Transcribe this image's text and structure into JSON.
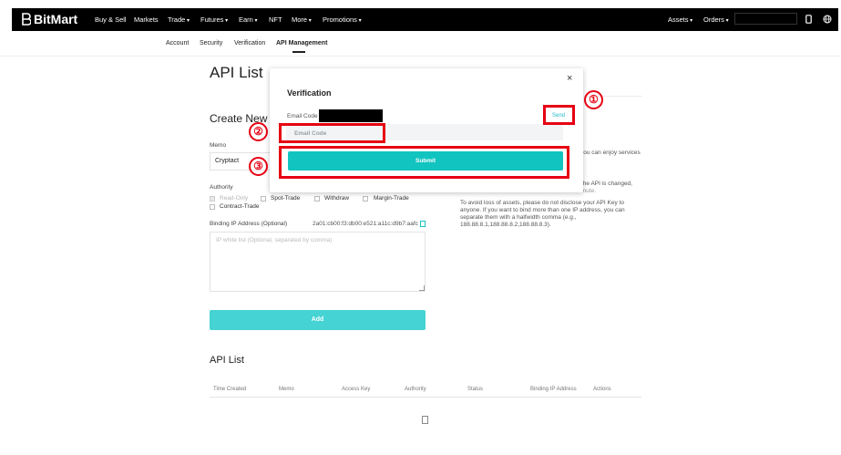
{
  "nav": {
    "logo": "BitMart",
    "items": [
      "Buy & Sell",
      "Markets",
      "Trade",
      "Futures",
      "Earn",
      "NFT",
      "More",
      "Promotions"
    ],
    "right": [
      "Assets",
      "Orders"
    ]
  },
  "subnav": [
    "Account",
    "Security",
    "Verification",
    "API Management"
  ],
  "page": {
    "title": "API List",
    "create_title": "Create New A",
    "memo_label": "Memo",
    "memo_value": "Cryptact",
    "authority_label": "Authority",
    "authority_options": [
      {
        "label": "Read-Only",
        "checked": true,
        "disabled": true
      },
      {
        "label": "Spot-Trade",
        "checked": false
      },
      {
        "label": "Withdraw",
        "checked": false
      },
      {
        "label": "Margin-Trade",
        "checked": false
      },
      {
        "label": "Contract-Trade",
        "checked": false
      }
    ],
    "ip_label": "Binding IP Address (Optional)",
    "ip_value": "2a01:cb00:f3:db00:e521:a11c:d9b7:aafc",
    "ip_placeholder": "IP white list (Optional, separated by comma)",
    "add_button": "Add",
    "api_list_title": "API List",
    "table_headers": [
      "Time Created",
      "Memo",
      "Access Key",
      "Authority",
      "Status",
      "Binding IP Address",
      "Actions"
    ],
    "notes": [
      "you can enjoy services",
      "r the API is changed,",
      "the instance function will take effect within 1 minute.",
      "To avoid loss of assets, please do not disclose your API Key to",
      "anyone. If you want to bind more than one IP address, you can",
      "separate them with a halfwidth comma (e.g.,",
      "188.88.8.1,188.88.8.2,188.88.8.3)."
    ]
  },
  "modal": {
    "title": "Verification",
    "close": "×",
    "email_label": "Email Code",
    "send": "Send",
    "placeholder": "Email Code",
    "submit": "Submit"
  },
  "annotations": {
    "marker_1": "①",
    "marker_2": "②",
    "marker_3": "③",
    "color": "#e60012"
  }
}
